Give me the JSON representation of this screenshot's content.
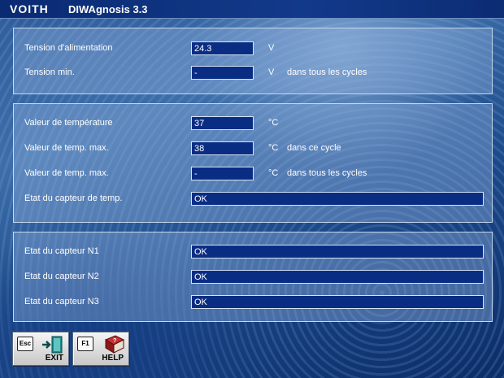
{
  "window": {
    "brand": "VOITH",
    "title": "DIWAgnosis 3.3"
  },
  "panel_voltage": {
    "rows": [
      {
        "label": "Tension d'alimentation",
        "value": "24.3",
        "unit": "V",
        "note": ""
      },
      {
        "label": "Tension min.",
        "value": "-",
        "unit": "V",
        "note": "dans tous les cycles"
      }
    ]
  },
  "panel_temperature": {
    "rows": [
      {
        "label": "Valeur de température",
        "value": "37",
        "unit": "°C",
        "note": ""
      },
      {
        "label": "Valeur de temp. max.",
        "value": "38",
        "unit": "°C",
        "note": "dans ce cycle"
      },
      {
        "label": "Valeur de temp. max.",
        "value": "-",
        "unit": "°C",
        "note": "dans tous les cycles"
      },
      {
        "label": "Etat du capteur de temp.",
        "value": "OK"
      }
    ]
  },
  "panel_sensors": {
    "rows": [
      {
        "label": "Etat du capteur N1",
        "value": "OK"
      },
      {
        "label": "Etat du capteur N2",
        "value": "OK"
      },
      {
        "label": "Etat du capteur N3",
        "value": "OK"
      }
    ]
  },
  "footer": {
    "exit_key": "Esc",
    "exit_label": "EXIT",
    "help_key": "F1",
    "help_label": "HELP"
  },
  "colors": {
    "field_bg": "#0a2d84",
    "title_bar": "#0a2a72"
  },
  "icons": {
    "exit": "door-exit-icon",
    "help": "help-book-icon"
  }
}
